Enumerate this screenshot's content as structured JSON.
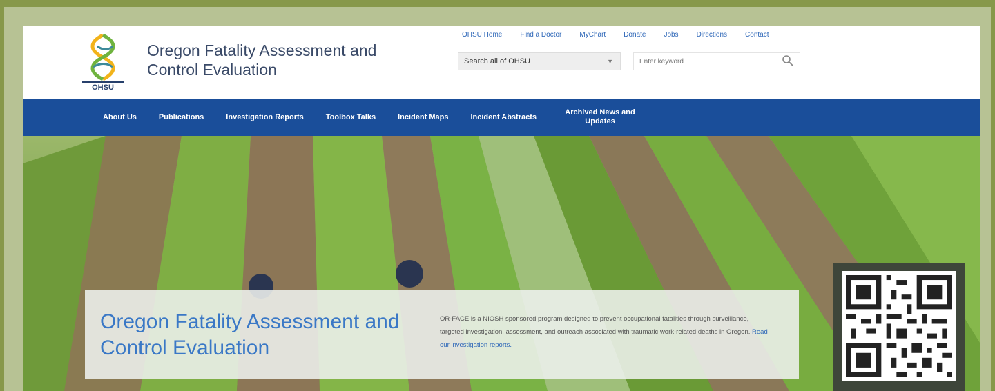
{
  "header": {
    "logo_text": "OHSU",
    "site_title": "Oregon Fatality Assessment and Control Evaluation",
    "util_links": [
      "OHSU Home",
      "Find a Doctor",
      "MyChart",
      "Donate",
      "Jobs",
      "Directions",
      "Contact"
    ],
    "search_scope": "Search all of OHSU",
    "search_placeholder": "Enter keyword"
  },
  "nav": {
    "items": [
      "About Us",
      "Publications",
      "Investigation Reports",
      "Toolbox Talks",
      "Incident Maps",
      "Incident Abstracts",
      "Archived News and Updates"
    ]
  },
  "hero": {
    "title": "Oregon Fatality Assessment and Control Evaluation",
    "description": "OR-FACE is a NIOSH sponsored program designed to prevent occupational fatalities through surveillance, targeted investigation, assessment, and outreach associated with traumatic work-related deaths in Oregon.",
    "link_text": "Read our investigation reports."
  },
  "colors": {
    "nav_bg": "#1a4e9a",
    "accent_blue": "#3a78c6",
    "frame_green": "#87984a"
  }
}
